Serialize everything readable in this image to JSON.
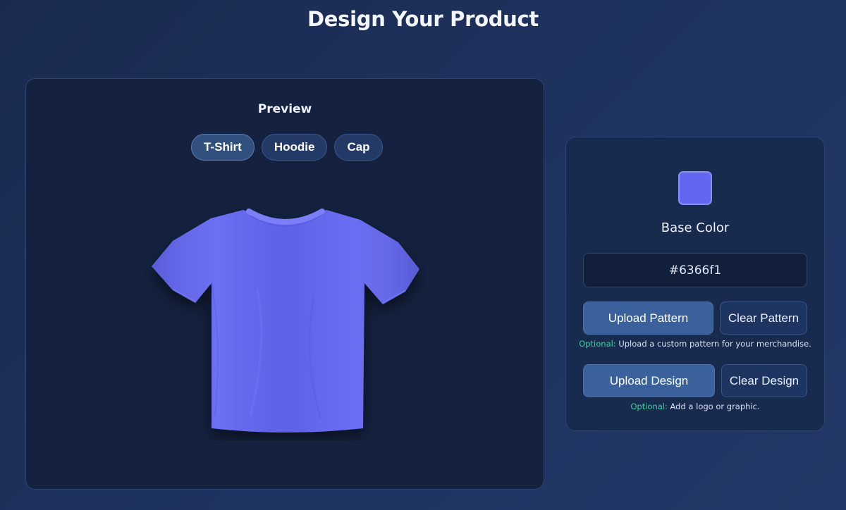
{
  "page": {
    "title": "Design Your Product"
  },
  "preview": {
    "heading": "Preview",
    "tabs": [
      {
        "label": "T-Shirt",
        "active": true
      },
      {
        "label": "Hoodie",
        "active": false
      },
      {
        "label": "Cap",
        "active": false
      }
    ]
  },
  "controls": {
    "base_color_label": "Base Color",
    "base_color_value": "#6366f1",
    "upload_pattern_label": "Upload Pattern",
    "clear_pattern_label": "Clear Pattern",
    "pattern_hint_optional": "Optional:",
    "pattern_hint_text": " Upload a custom pattern for your merchandise.",
    "upload_design_label": "Upload Design",
    "clear_design_label": "Clear Design",
    "design_hint_optional": "Optional:",
    "design_hint_text": " Add a logo or graphic."
  },
  "colors": {
    "shirt": "#6366f1",
    "accent_optional": "#34d399"
  }
}
